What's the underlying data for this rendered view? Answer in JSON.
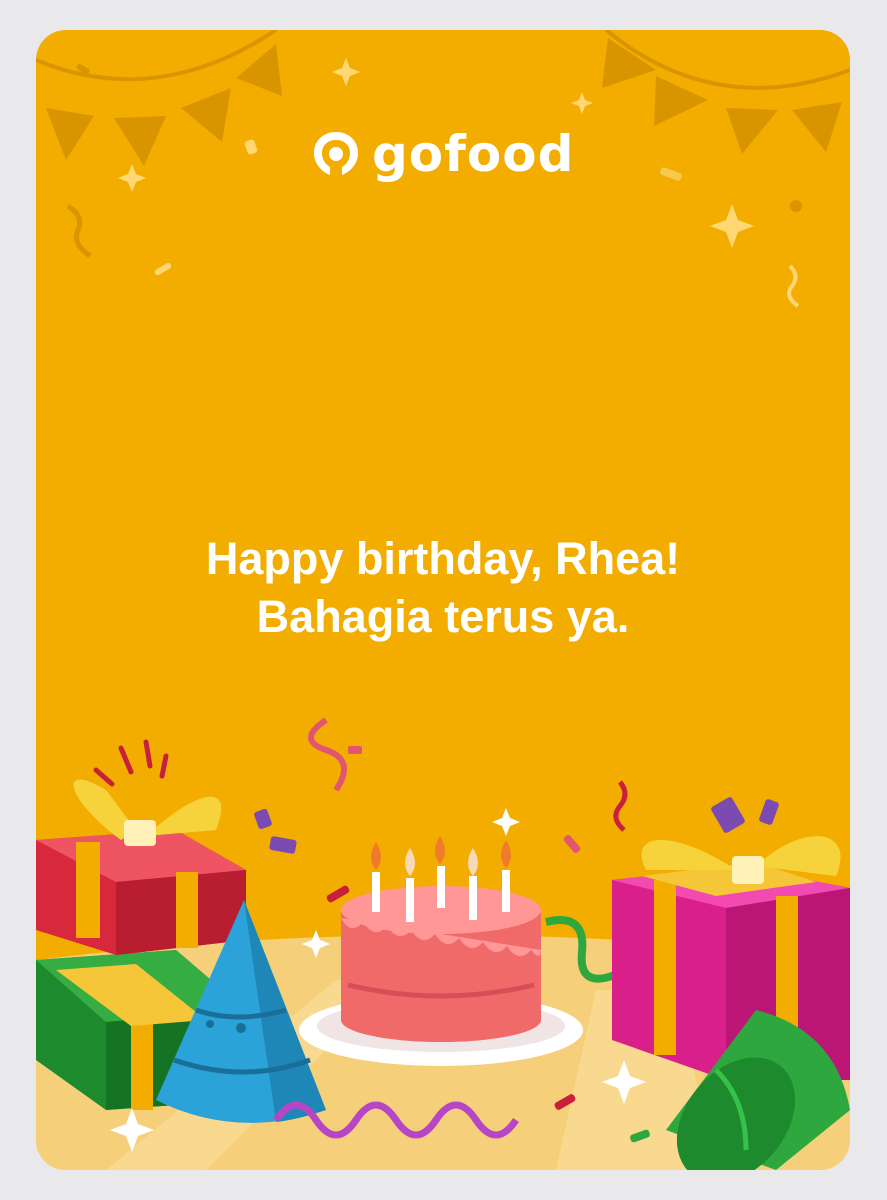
{
  "brand": {
    "name": "gofood",
    "logo_icon": "gofood-logo-icon",
    "color": "#ffffff"
  },
  "card": {
    "background": "#f2ad00",
    "greeting_line1": "Happy birthday, Rhea!",
    "greeting_line2": "Bahagia terus ya."
  }
}
